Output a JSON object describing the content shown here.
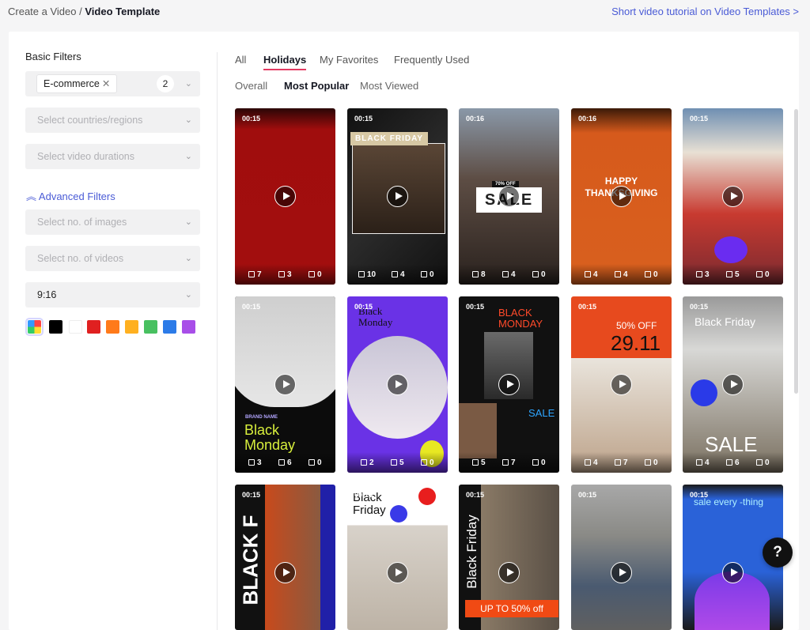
{
  "breadcrumb": {
    "parent": "Create a Video",
    "separator": "/",
    "current": "Video Template"
  },
  "tutorial_link": "Short video tutorial on Video Templates >",
  "filters": {
    "title": "Basic Filters",
    "category_chip": "E-commerce",
    "category_count": "2",
    "countries_placeholder": "Select countries/regions",
    "durations_placeholder": "Select video durations",
    "advanced_label": "Advanced Filters",
    "images_placeholder": "Select no. of images",
    "videos_placeholder": "Select no. of videos",
    "ratio_value": "9:16",
    "colors": [
      "multi",
      "#000000",
      "#ffffff",
      "#e02020",
      "#ff7a1a",
      "#ffb020",
      "#48c060",
      "#2c7be8",
      "#a84ee8"
    ]
  },
  "tabs": [
    {
      "label": "All",
      "active": false
    },
    {
      "label": "Holidays",
      "active": true
    },
    {
      "label": "My Favorites",
      "active": false
    },
    {
      "label": "Frequently Used",
      "active": false
    }
  ],
  "subtabs": [
    {
      "label": "Overall",
      "active": false
    },
    {
      "label": "Most Popular",
      "active": true
    },
    {
      "label": "Most Viewed",
      "active": false
    }
  ],
  "accent_color": "#e33a62",
  "link_color": "#4a5bd6",
  "cards": [
    {
      "duration": "00:15",
      "texts": 7,
      "images": 3,
      "videos": 0
    },
    {
      "duration": "00:15",
      "texts": 10,
      "images": 4,
      "videos": 0,
      "overlay": "BLACK FRIDAY"
    },
    {
      "duration": "00:16",
      "texts": 8,
      "images": 4,
      "videos": 0,
      "overlay": "SALE",
      "badge": "70% OFF"
    },
    {
      "duration": "00:16",
      "texts": 4,
      "images": 4,
      "videos": 0,
      "overlay": "HAPPY THANKSGIVING"
    },
    {
      "duration": "00:15",
      "texts": 3,
      "images": 5,
      "videos": 0
    },
    {
      "duration": "00:15",
      "texts": 3,
      "images": 6,
      "videos": 0,
      "overlay": "Black Monday",
      "sub": "BRAND NAME"
    },
    {
      "duration": "00:15",
      "texts": 2,
      "images": 5,
      "videos": 0,
      "overlay": "Black Monday"
    },
    {
      "duration": "00:15",
      "texts": 5,
      "images": 7,
      "videos": 0,
      "overlay": "BLACK MONDAY",
      "sub": "SALE"
    },
    {
      "duration": "00:15",
      "texts": 4,
      "images": 7,
      "videos": 0,
      "overlay": "50% OFF",
      "sub": "29.11"
    },
    {
      "duration": "00:15",
      "texts": 4,
      "images": 6,
      "videos": 0,
      "overlay": "Black Friday",
      "sub": "SALE"
    },
    {
      "duration": "00:15",
      "overlay": "BLACK F"
    },
    {
      "duration": "00:15",
      "overlay": "Black Friday"
    },
    {
      "duration": "00:15",
      "overlay": "Black Friday",
      "sub": "UP TO 50% off"
    },
    {
      "duration": "00:15"
    },
    {
      "duration": "00:15",
      "overlay": "sale every -thing"
    }
  ],
  "help_icon": "?"
}
